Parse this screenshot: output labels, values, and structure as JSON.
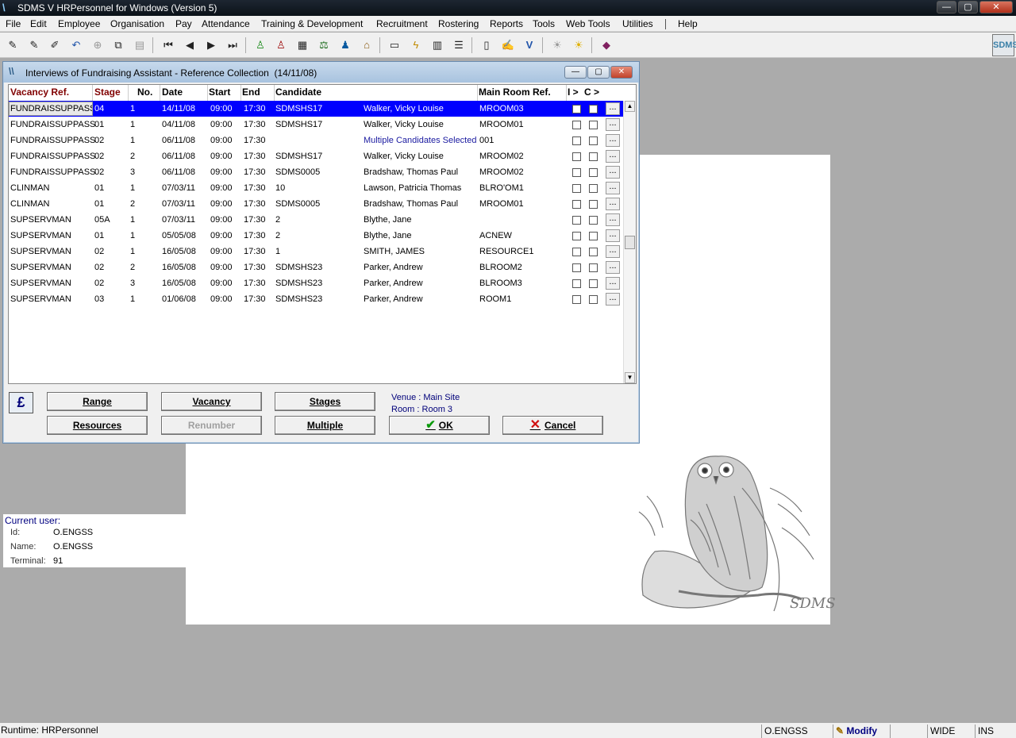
{
  "app": {
    "title": "SDMS V HRPersonnel for Windows (Version 5)",
    "window_buttons": [
      "—",
      "▢",
      "✕"
    ]
  },
  "menu": [
    "File",
    "Edit",
    "Employee",
    "Organisation",
    "Pay",
    "Attendance",
    "Training & Development",
    "Recruitment",
    "Rostering",
    "Reports",
    "Tools",
    "Web Tools",
    "Utilities",
    "Help"
  ],
  "toolbar": {
    "icons": [
      "pencil-icon",
      "pencil-plus-icon",
      "pencil-edit-icon",
      "undo-icon",
      "binoculars-icon",
      "copy-icon",
      "paste-icon",
      "first-record-icon",
      "previous-record-icon",
      "next-record-icon",
      "last-record-icon",
      "person-green-icon",
      "person-cross-icon",
      "calendar-icon",
      "scales-icon",
      "people-icon",
      "building-icon",
      "book-icon",
      "lightning-icon",
      "table-icon",
      "list-icon",
      "report-icon",
      "pencil-report-icon",
      "check-v-icon",
      "lightbulb-icon",
      "lightbulb-on-icon",
      "book-closed-icon"
    ],
    "logo_text": "SDMS"
  },
  "dialog": {
    "title": "Interviews of Fundraising Assistant - Reference Collection",
    "date": "(14/11/08)",
    "columns": [
      "Vacancy Ref.",
      "Stage",
      "No.",
      "Date",
      "Start",
      "End",
      "Candidate",
      "Main Room Ref.",
      "I >",
      "C >"
    ],
    "rows": [
      {
        "vacancy": "FUNDRAISSUPPASS",
        "stage": "04",
        "no": "1",
        "date": "14/11/08",
        "start": "09:00",
        "end": "17:30",
        "cand_id": "SDMSHS17",
        "cand_name": "Walker, Vicky Louise",
        "room": "MROOM03",
        "selected": true
      },
      {
        "vacancy": "FUNDRAISSUPPASS",
        "stage": "01",
        "no": "1",
        "date": "04/11/08",
        "start": "09:00",
        "end": "17:30",
        "cand_id": "SDMSHS17",
        "cand_name": "Walker, Vicky Louise",
        "room": "MROOM01"
      },
      {
        "vacancy": "FUNDRAISSUPPASS",
        "stage": "02",
        "no": "1",
        "date": "06/11/08",
        "start": "09:00",
        "end": "17:30",
        "cand_id": "",
        "cand_name": "Multiple Candidates Selected",
        "room": "001",
        "multi": true
      },
      {
        "vacancy": "FUNDRAISSUPPASS",
        "stage": "02",
        "no": "2",
        "date": "06/11/08",
        "start": "09:00",
        "end": "17:30",
        "cand_id": "SDMSHS17",
        "cand_name": "Walker, Vicky Louise",
        "room": "MROOM02"
      },
      {
        "vacancy": "FUNDRAISSUPPASS",
        "stage": "02",
        "no": "3",
        "date": "06/11/08",
        "start": "09:00",
        "end": "17:30",
        "cand_id": "SDMS0005",
        "cand_name": "Bradshaw, Thomas Paul",
        "room": "MROOM02"
      },
      {
        "vacancy": "CLINMAN",
        "stage": "01",
        "no": "1",
        "date": "07/03/11",
        "start": "09:00",
        "end": "17:30",
        "cand_id": "10",
        "cand_name": "Lawson, Patricia Thomas",
        "room": "BLRO'OM1"
      },
      {
        "vacancy": "CLINMAN",
        "stage": "01",
        "no": "2",
        "date": "07/03/11",
        "start": "09:00",
        "end": "17:30",
        "cand_id": "SDMS0005",
        "cand_name": "Bradshaw, Thomas Paul",
        "room": "MROOM01"
      },
      {
        "vacancy": "SUPSERVMAN",
        "stage": "05A",
        "no": "1",
        "date": "07/03/11",
        "start": "09:00",
        "end": "17:30",
        "cand_id": "2",
        "cand_name": "Blythe, Jane",
        "room": ""
      },
      {
        "vacancy": "SUPSERVMAN",
        "stage": "01",
        "no": "1",
        "date": "05/05/08",
        "start": "09:00",
        "end": "17:30",
        "cand_id": "2",
        "cand_name": "Blythe, Jane",
        "room": "ACNEW"
      },
      {
        "vacancy": "SUPSERVMAN",
        "stage": "02",
        "no": "1",
        "date": "16/05/08",
        "start": "09:00",
        "end": "17:30",
        "cand_id": "1",
        "cand_name": "SMITH, JAMES",
        "room": "RESOURCE1"
      },
      {
        "vacancy": "SUPSERVMAN",
        "stage": "02",
        "no": "2",
        "date": "16/05/08",
        "start": "09:00",
        "end": "17:30",
        "cand_id": "SDMSHS23",
        "cand_name": "Parker, Andrew",
        "room": "BLROOM2"
      },
      {
        "vacancy": "SUPSERVMAN",
        "stage": "02",
        "no": "3",
        "date": "16/05/08",
        "start": "09:00",
        "end": "17:30",
        "cand_id": "SDMSHS23",
        "cand_name": "Parker, Andrew",
        "room": "BLROOM3"
      },
      {
        "vacancy": "SUPSERVMAN",
        "stage": "03",
        "no": "1",
        "date": "01/06/08",
        "start": "09:00",
        "end": "17:30",
        "cand_id": "SDMSHS23",
        "cand_name": "Parker, Andrew",
        "room": "ROOM1"
      }
    ],
    "ellipsis": "...",
    "pound_symbol": "£",
    "buttons": {
      "range": "Range",
      "vacancy": "Vacancy",
      "stages": "Stages",
      "resources": "Resources",
      "renumber": "Renumber",
      "multiple": "Multiple",
      "ok": "OK",
      "cancel": "Cancel"
    },
    "venue": "Venue : Main Site",
    "room": "Room : Room 3"
  },
  "current_user": {
    "heading": "Current user:",
    "id_label": "Id:",
    "id_value": "O.ENGSS",
    "name_label": "Name:",
    "name_value": "O.ENGSS",
    "terminal_label": "Terminal:",
    "terminal_value": "91"
  },
  "background": {
    "watermark": "SDMS"
  },
  "status": {
    "runtime": "Runtime: HRPersonnel",
    "user": "O.ENGSS",
    "mode": "Modify",
    "width": "WIDE",
    "insert": "INS"
  }
}
